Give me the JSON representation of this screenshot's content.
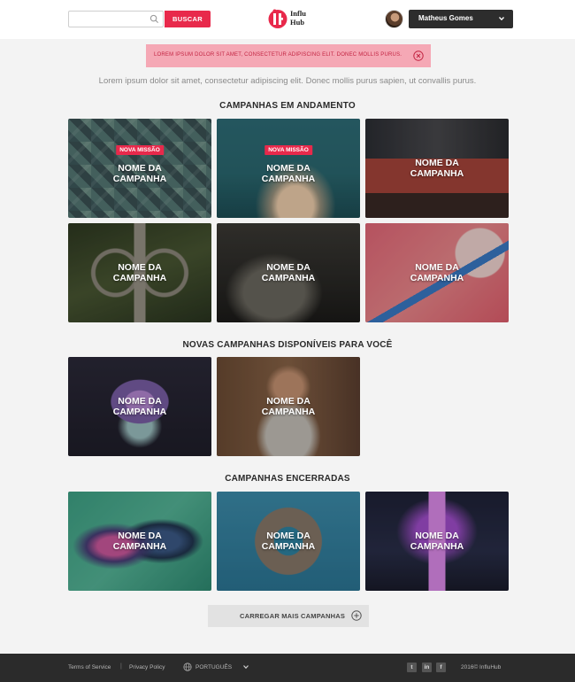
{
  "header": {
    "search": {
      "placeholder": "",
      "value": ""
    },
    "search_button": "BUSCAR",
    "logo": {
      "line1": "Influ",
      "line2": "Hub"
    },
    "user": {
      "name": "Matheus Gomes"
    }
  },
  "alert": {
    "message": "LOREM IPSUM DOLOR SIT AMET, CONSECTETUR ADIPISCING ELIT. DONEC MOLLIS PURUS."
  },
  "intro": "Lorem ipsum dolor sit amet, consectetur adipiscing elit. Donec mollis purus sapien, ut convallis purus.",
  "sections": {
    "ongoing": {
      "title": "CAMPANHAS EM ANDAMENTO",
      "cards": [
        {
          "badge": "NOVA MISSÃO",
          "line1": "NOME DA",
          "line2": "CAMPANHA"
        },
        {
          "badge": "NOVA MISSÃO",
          "line1": "NOME DA",
          "line2": "CAMPANHA"
        },
        {
          "badge": "",
          "line1": "NOME DA",
          "line2": "CAMPANHA"
        },
        {
          "badge": "",
          "line1": "NOME DA",
          "line2": "CAMPANHA"
        },
        {
          "badge": "",
          "line1": "NOME DA",
          "line2": "CAMPANHA"
        },
        {
          "badge": "",
          "line1": "NOME DA",
          "line2": "CAMPANHA"
        }
      ]
    },
    "new": {
      "title": "NOVAS CAMPANHAS DISPONÍVEIS PARA VOCÊ",
      "cards": [
        {
          "line1": "NOME DA",
          "line2": "CAMPANHA"
        },
        {
          "line1": "NOME DA",
          "line2": "CAMPANHA"
        }
      ]
    },
    "closed": {
      "title": "CAMPANHAS ENCERRADAS",
      "cards": [
        {
          "line1": "NOME DA",
          "line2": "CAMPANHA"
        },
        {
          "line1": "NOME DA",
          "line2": "CAMPANHA"
        },
        {
          "line1": "NOME DA",
          "line2": "CAMPANHA"
        }
      ]
    }
  },
  "load_more": "CARREGAR MAIS CAMPANHAS",
  "footer": {
    "terms": "Terms of Service",
    "separator": "|",
    "privacy": "Privacy Policy",
    "language": "PORTUGUÊS",
    "social": {
      "twitter": "t",
      "linkedin": "in",
      "facebook": "f"
    },
    "copyright": "2016© InfluHub"
  },
  "colors": {
    "accent": "#e8294b",
    "dark": "#2b2b2b",
    "alert_bg": "#f5a8b5"
  }
}
